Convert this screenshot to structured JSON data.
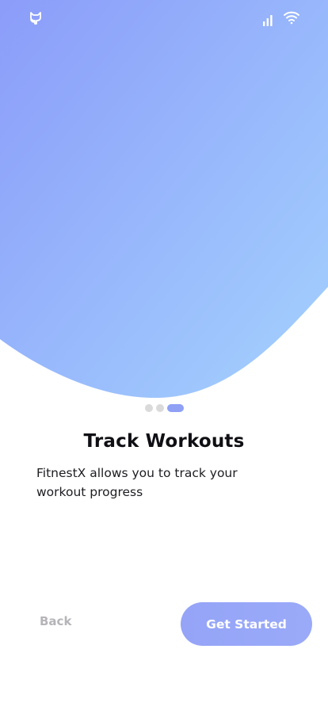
{
  "status_bar": {
    "left_icon": "github-icon",
    "right_icons": [
      "signal-icon",
      "wifi-icon"
    ]
  },
  "carousel": {
    "total": 3,
    "active_index": 2
  },
  "content": {
    "title": "Track Workouts",
    "description": "FitnestX allows you to track your workout progress"
  },
  "actions": {
    "back_label": "Back",
    "cta_label": "Get Started"
  },
  "colors": {
    "gradient_start": "#8b9cf9",
    "gradient_end": "#a4d2fe",
    "accent": "#95a4f7",
    "dot_inactive": "#dadada",
    "back_text": "#b6b4b8"
  }
}
